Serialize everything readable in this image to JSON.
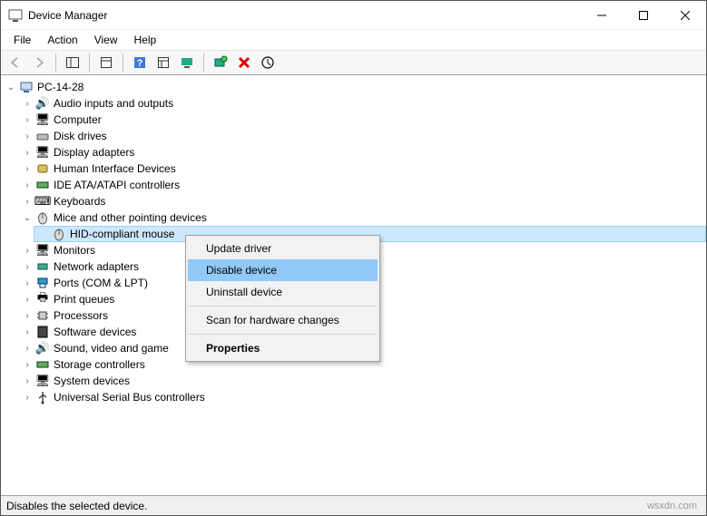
{
  "window": {
    "title": "Device Manager"
  },
  "menu": {
    "file": "File",
    "action": "Action",
    "view": "View",
    "help": "Help"
  },
  "tree": {
    "root": "PC-14-28",
    "node_audio": "Audio inputs and outputs",
    "node_computer": "Computer",
    "node_disk": "Disk drives",
    "node_display": "Display adapters",
    "node_hid": "Human Interface Devices",
    "node_ide": "IDE ATA/ATAPI controllers",
    "node_keyboards": "Keyboards",
    "node_mice": "Mice and other pointing devices",
    "node_hid_mouse": "HID-compliant mouse",
    "node_monitors": "Monitors",
    "node_network": "Network adapters",
    "node_ports": "Ports (COM & LPT)",
    "node_print": "Print queues",
    "node_processors": "Processors",
    "node_software": "Software devices",
    "node_sound": "Sound, video and game",
    "node_storage": "Storage controllers",
    "node_system": "System devices",
    "node_usb": "Universal Serial Bus controllers"
  },
  "context": {
    "update": "Update driver",
    "disable": "Disable device",
    "uninstall": "Uninstall device",
    "scan": "Scan for hardware changes",
    "properties": "Properties"
  },
  "status": {
    "text": "Disables the selected device."
  },
  "watermark": "wsxdn.com"
}
